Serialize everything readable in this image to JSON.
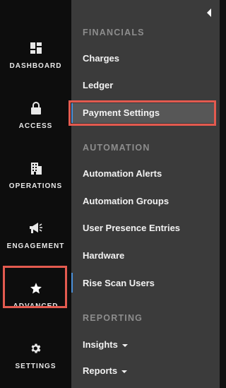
{
  "rail": {
    "items": [
      {
        "label": "DASHBOARD",
        "icon": "dashboard-icon"
      },
      {
        "label": "ACCESS",
        "icon": "lock-icon"
      },
      {
        "label": "OPERATIONS",
        "icon": "building-icon"
      },
      {
        "label": "ENGAGEMENT",
        "icon": "megaphone-icon"
      },
      {
        "label": "ADVANCED",
        "icon": "star-icon"
      },
      {
        "label": "SETTINGS",
        "icon": "gear-icon"
      }
    ]
  },
  "panel": {
    "collapse_icon": "chevron-left-icon",
    "sections": [
      {
        "title": "FINANCIALS",
        "items": [
          "Charges",
          "Ledger",
          "Payment Settings"
        ]
      },
      {
        "title": "AUTOMATION",
        "items": [
          "Automation Alerts",
          "Automation Groups",
          "User Presence Entries",
          "Hardware",
          "Rise Scan Users"
        ]
      },
      {
        "title": "REPORTING",
        "items": [
          "Insights",
          "Reports"
        ]
      }
    ]
  },
  "colors": {
    "rail_bg": "#0d0d0d",
    "panel_bg": "#3b3b3b",
    "section_title": "#8d8d8d",
    "highlight_border": "#e35a4f",
    "active_accent": "#4a90d9"
  }
}
